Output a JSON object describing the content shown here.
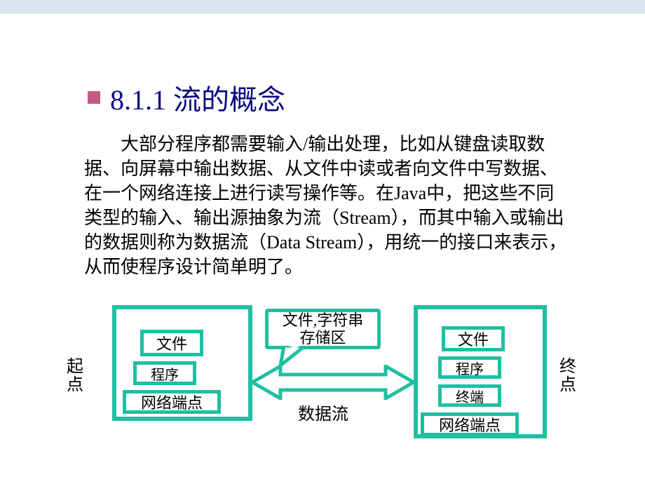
{
  "title": "8.1.1 流的概念",
  "body": "大部分程序都需要输入/输出处理，比如从键盘读取数据、向屏幕中输出数据、从文件中读或者向文件中写数据、在一个网络连接上进行读写操作等。在Java中，把这些不同类型的输入、输出源抽象为流（Stream），而其中输入或输出的数据则称为数据流（Data Stream），用统一的接口来表示，从而使程序设计简单明了。",
  "diagram": {
    "left_label": "起\n点",
    "right_label": "终\n点",
    "left_items": {
      "file": "文件",
      "program": "程序",
      "network": "网络端点"
    },
    "right_items": {
      "file": "文件",
      "program": "程序",
      "terminal": "终端",
      "network": "网络端点"
    },
    "callout": "文件,字符串\n存储区",
    "flow_label": "数据流"
  }
}
